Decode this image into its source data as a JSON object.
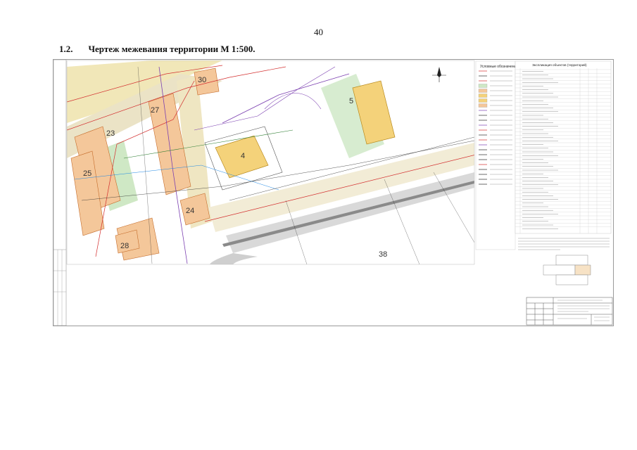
{
  "page": {
    "number": "40"
  },
  "section": {
    "number": "1.2.",
    "title": "Чертеж межевания территории М 1:500."
  },
  "drawing": {
    "legend_title": "Условные обозначения",
    "table_title": "Экспликация объектов (территорий)",
    "block_labels": [
      "30",
      "27",
      "23",
      "25",
      "28",
      "24",
      "4",
      "5",
      "38"
    ],
    "colors": {
      "residential": "#f4c79a",
      "public": "#f4d27a",
      "road": "#f1e7b8",
      "green": "#cfe8c5",
      "line_red": "#d32f2f",
      "line_purple": "#7b3fb0",
      "line_dark": "#2b2b2b"
    },
    "icons": [
      "north-arrow-icon"
    ]
  }
}
